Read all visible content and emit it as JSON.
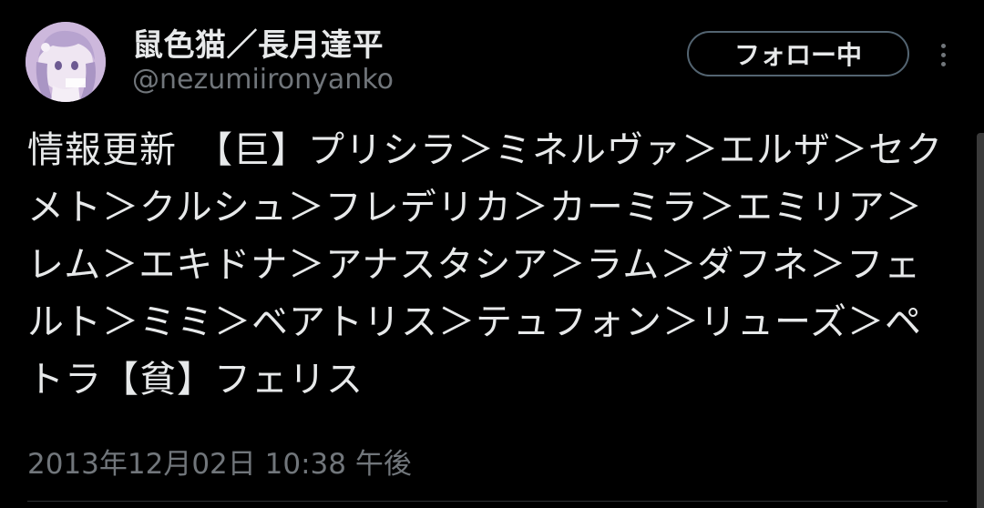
{
  "user": {
    "display_name": "鼠色猫／長月達平",
    "handle": "@nezumiironyanko"
  },
  "actions": {
    "follow_label": "フォロー中",
    "more_icon": "more-vertical-icon"
  },
  "tweet": {
    "text": "情報更新　【巨】プリシラ＞ミネルヴァ＞エルザ＞セクメト＞クルシュ＞フレデリカ＞カーミラ＞エミリア＞レム＞エキドナ＞アナスタシア＞ラム＞ダフネ＞フェルト＞ミミ＞ベアトリス＞テュフォン＞リューズ＞ペトラ【貧】フェリス",
    "timestamp": "2013年12月02日 10:38 午後"
  },
  "colors": {
    "background": "#000000",
    "text_primary": "#e7e9ea",
    "text_secondary": "#71767b",
    "button_border": "#536471"
  }
}
